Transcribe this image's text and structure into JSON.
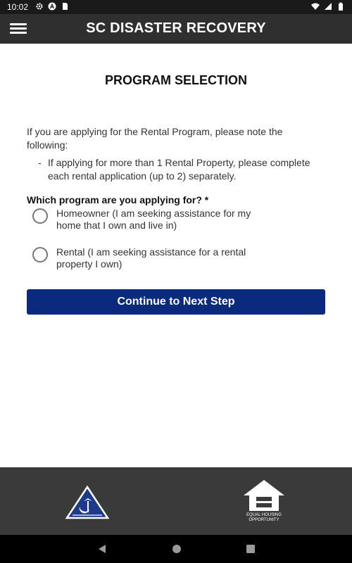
{
  "status_bar": {
    "time": "10:02",
    "left_icons": [
      "gear-icon",
      "a-badge-icon",
      "sim-card-icon"
    ],
    "right_icons": [
      "wifi-icon",
      "signal-icon",
      "battery-icon"
    ]
  },
  "app_bar": {
    "title": "SC DISASTER RECOVERY",
    "menu_icon": "hamburger-menu-icon"
  },
  "main": {
    "page_title": "PROGRAM SELECTION",
    "intro_text": "If you are applying for the Rental Program, please note the following:",
    "bullet_dash": "-",
    "bullet_text": "If applying for more than 1 Rental Property, please complete each rental application (up to 2) separately.",
    "question": "Which program are you applying for? *",
    "options": [
      {
        "label": "Homeowner (I am seeking assistance for my home that I own and live in)",
        "selected": false
      },
      {
        "label": "Rental (I am seeking assistance for a rental property I own)",
        "selected": false
      }
    ],
    "continue_label": "Continue to Next Step"
  },
  "footer": {
    "left_logo": "sc-disaster-recovery-logo",
    "right_logo_line1": "EQUAL HOUSING",
    "right_logo_line2": "OPPORTUNITY"
  },
  "nav_bar": {
    "icons": [
      "back-icon",
      "home-icon",
      "recent-apps-icon"
    ]
  },
  "colors": {
    "status_bar": "#1a1a1a",
    "app_bar": "#2f2f2f",
    "button": "#0a2b7d",
    "footer": "#3a3a3a"
  }
}
